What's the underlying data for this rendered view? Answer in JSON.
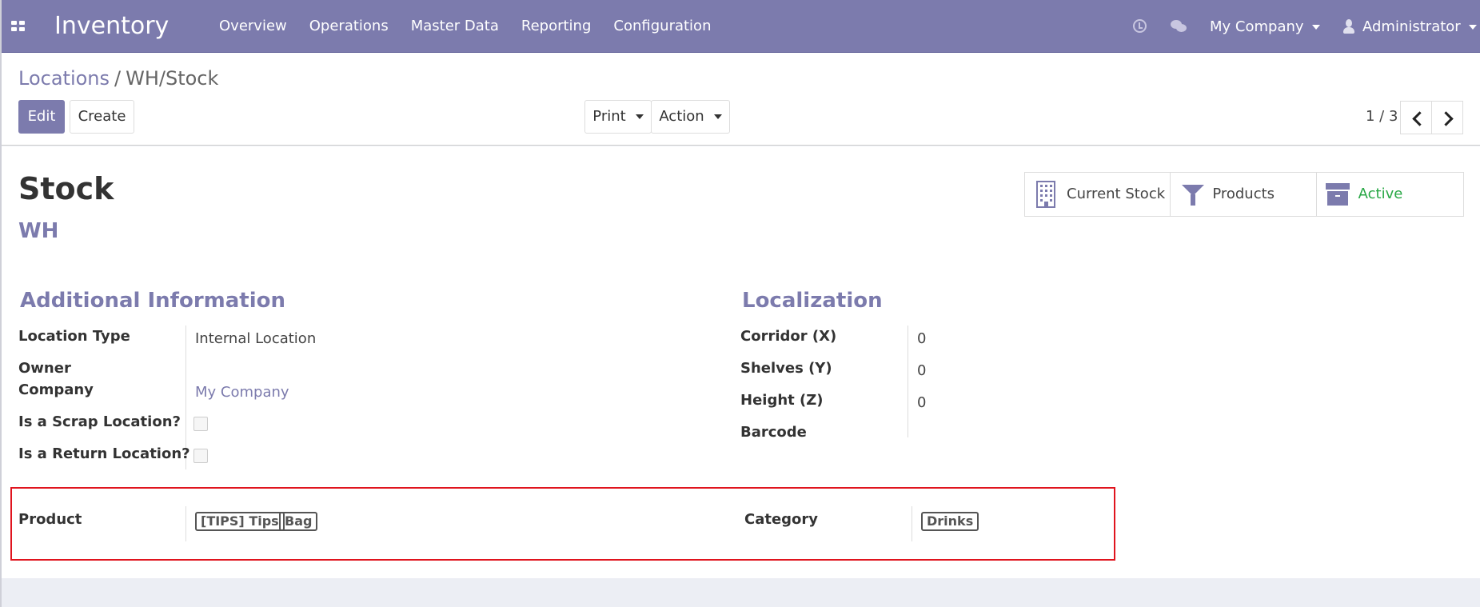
{
  "navbar": {
    "app_title": "Inventory",
    "menu": [
      "Overview",
      "Operations",
      "Master Data",
      "Reporting",
      "Configuration"
    ],
    "company": "My Company",
    "user": "Administrator",
    "bg_color": "#7c7bad"
  },
  "breadcrumb": {
    "parent": "Locations",
    "separator": "/",
    "current": "WH/Stock"
  },
  "toolbar": {
    "edit": "Edit",
    "create": "Create",
    "print": "Print",
    "action": "Action"
  },
  "pager": {
    "value": "1 / 3"
  },
  "record": {
    "name": "Stock",
    "parent": "WH"
  },
  "smart_buttons": {
    "current_stock": "Current Stock",
    "products": "Products",
    "active": "Active"
  },
  "additional_info": {
    "title": "Additional Information",
    "location_type_label": "Location Type",
    "location_type_value": "Internal Location",
    "owner_label": "Owner",
    "company_label": "Company",
    "company_value": "My Company",
    "scrap_label": "Is a Scrap Location?",
    "return_label": "Is a Return Location?"
  },
  "localization": {
    "title": "Localization",
    "corridor_label": "Corridor (X)",
    "corridor_value": "0",
    "shelves_label": "Shelves (Y)",
    "shelves_value": "0",
    "height_label": "Height (Z)",
    "height_value": "0",
    "barcode_label": "Barcode"
  },
  "restrictions": {
    "product_label": "Product",
    "product_tags": [
      "[TIPS] Tips",
      "Bag"
    ],
    "category_label": "Category",
    "category_tags": [
      "Drinks"
    ],
    "highlight_color": "#e0141e"
  }
}
